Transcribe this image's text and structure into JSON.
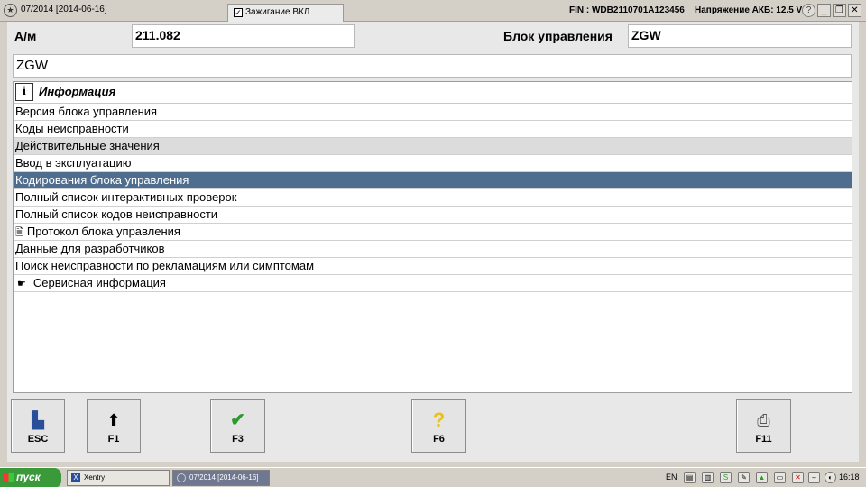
{
  "window": {
    "title": "07/2014 [2014-06-16]",
    "ignition_label": "Зажигание ВКЛ",
    "ignition_checked": true,
    "fin": "FIN : WDB2110701A123456",
    "battery_voltage": "Напряжение АКБ: 12.5 V"
  },
  "header": {
    "vehicle_label": "А/м",
    "vehicle_value": "211.082",
    "ecu_label": "Блок управления",
    "ecu_value": "ZGW",
    "ecu_name": "ZGW"
  },
  "list": {
    "header": "Информация",
    "items": [
      {
        "label": "Версия блока управления",
        "state": "normal"
      },
      {
        "label": "Коды неисправности",
        "state": "normal"
      },
      {
        "label": "Действительные значения",
        "state": "grey"
      },
      {
        "label": "Ввод в эксплуатацию",
        "state": "normal"
      },
      {
        "label": "Кодирования блока управления",
        "state": "selected"
      },
      {
        "label": "Полный список интерактивных проверок",
        "state": "normal"
      },
      {
        "label": "Полный список кодов неисправности",
        "state": "normal"
      },
      {
        "label": "Протокол блока управления",
        "state": "normal",
        "icon": "document-icon"
      },
      {
        "label": "Данные для разработчиков",
        "state": "normal"
      },
      {
        "label": "Поиск неисправности по рекламациям или симптомам",
        "state": "normal"
      },
      {
        "label": "Сервисная информация",
        "state": "normal",
        "icon": "service-hand-icon"
      }
    ]
  },
  "fkeys": [
    {
      "label": "ESC",
      "icon": "exit-door-icon"
    },
    {
      "label": "F1",
      "icon": "arrow-up-icon"
    },
    {
      "label": "F3",
      "icon": "checkmark-icon"
    },
    {
      "label": "F6",
      "icon": "help-question-icon"
    },
    {
      "label": "F11",
      "icon": "printer-icon"
    }
  ],
  "taskbar": {
    "start_label": "пуск",
    "task_xentry": "Xentry",
    "task_main": "07/2014 [2014-06-16]",
    "lang": "EN",
    "clock": "16:18"
  },
  "colors": {
    "selection": "#4f6d8f",
    "grey_row": "#dcdcdc",
    "panel": "#e8e8e8",
    "start_button": "#3a9a3a",
    "check_green": "#2e9a2e",
    "help_yellow": "#e8c21a"
  }
}
